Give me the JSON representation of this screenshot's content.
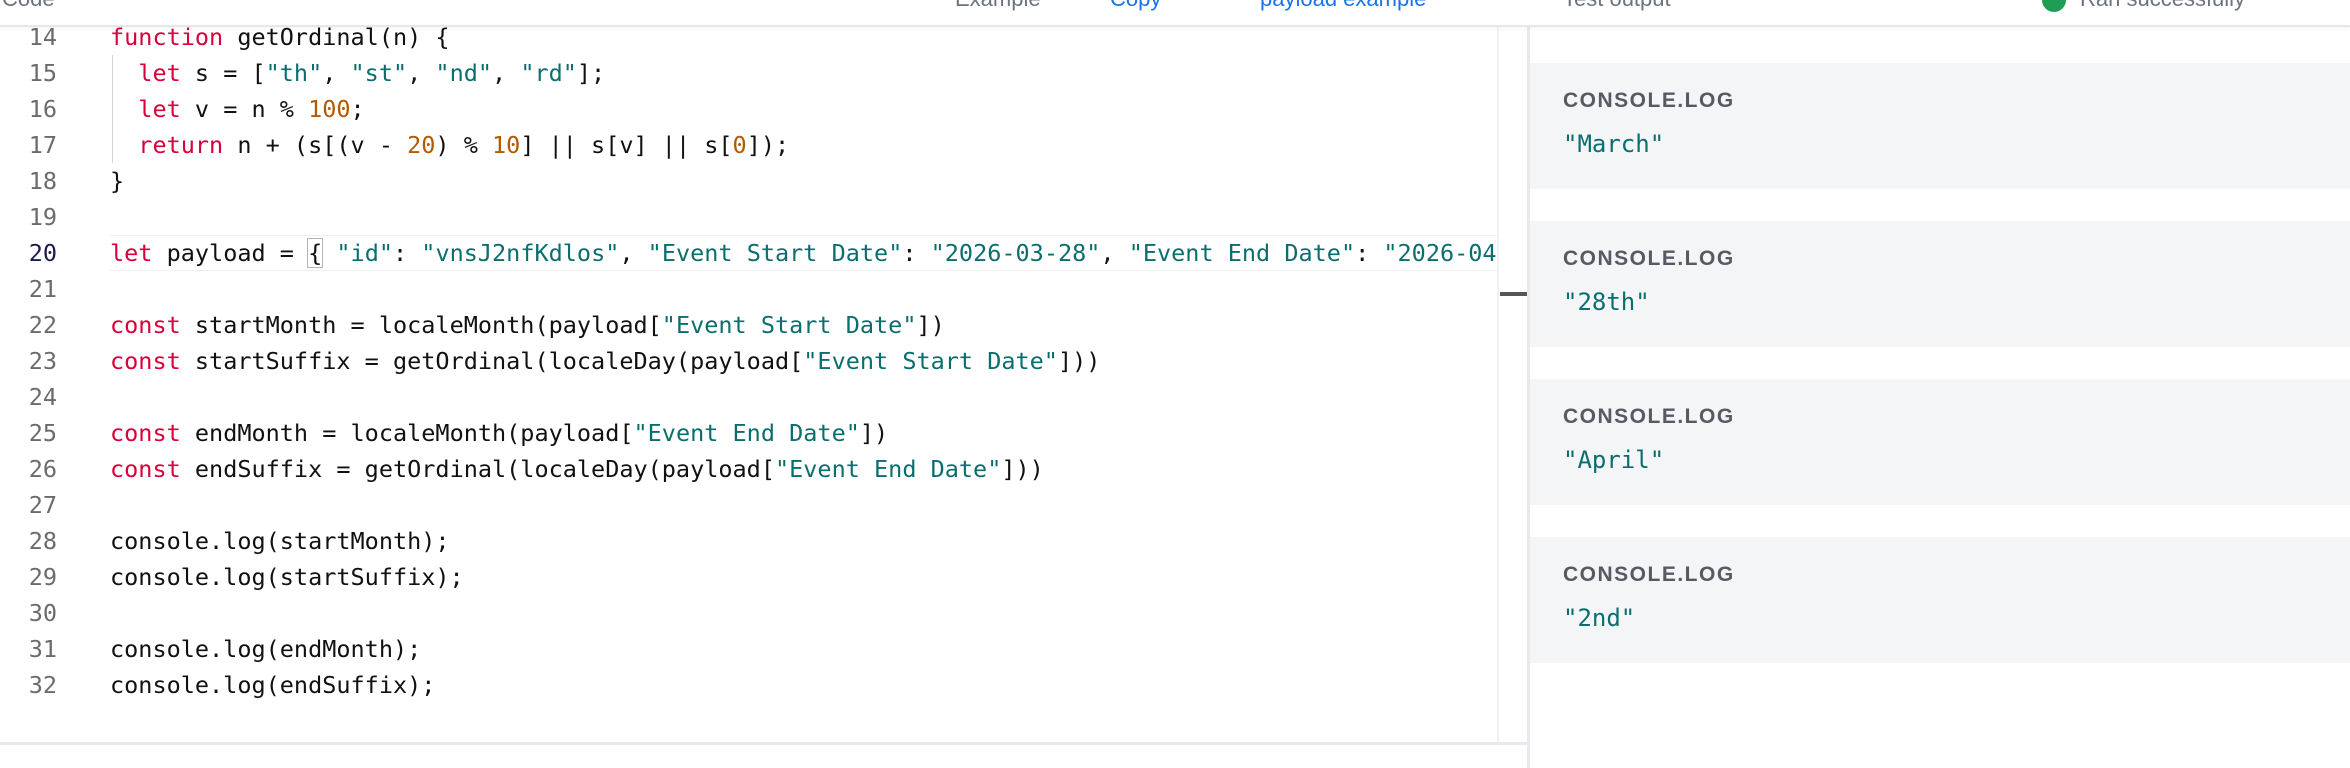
{
  "header": {
    "left_fragment": "Code",
    "mid_fragment_1": "Example",
    "mid_fragment_2": "Copy",
    "mid_fragment_3": "payload example",
    "output_fragment": "Test output",
    "status_text": "Ran successfully"
  },
  "editor": {
    "active_line": 20,
    "lines": [
      {
        "n": "14",
        "tokens": [
          [
            "kw",
            "function"
          ],
          [
            "pl",
            " getOrdinal(n) {"
          ]
        ]
      },
      {
        "n": "15",
        "tokens": [
          [
            "pl",
            "  "
          ],
          [
            "kw",
            "let"
          ],
          [
            "pl",
            " s = ["
          ],
          [
            "str",
            "\"th\""
          ],
          [
            "pl",
            ", "
          ],
          [
            "str",
            "\"st\""
          ],
          [
            "pl",
            ", "
          ],
          [
            "str",
            "\"nd\""
          ],
          [
            "pl",
            ", "
          ],
          [
            "str",
            "\"rd\""
          ],
          [
            "pl",
            "];"
          ]
        ]
      },
      {
        "n": "16",
        "tokens": [
          [
            "pl",
            "  "
          ],
          [
            "kw",
            "let"
          ],
          [
            "pl",
            " v = n % "
          ],
          [
            "num",
            "100"
          ],
          [
            "pl",
            ";"
          ]
        ]
      },
      {
        "n": "17",
        "tokens": [
          [
            "pl",
            "  "
          ],
          [
            "kw",
            "return"
          ],
          [
            "pl",
            " n + (s[(v - "
          ],
          [
            "num",
            "20"
          ],
          [
            "pl",
            ") % "
          ],
          [
            "num",
            "10"
          ],
          [
            "pl",
            "] || s[v] || s["
          ],
          [
            "num",
            "0"
          ],
          [
            "pl",
            "]);"
          ]
        ]
      },
      {
        "n": "18",
        "tokens": [
          [
            "pl",
            "}"
          ]
        ]
      },
      {
        "n": "19",
        "tokens": []
      },
      {
        "n": "20",
        "tokens": [
          [
            "kw",
            "let"
          ],
          [
            "pl",
            " payload = "
          ],
          [
            "brace",
            "{"
          ],
          [
            "pl",
            " "
          ],
          [
            "str",
            "\"id\""
          ],
          [
            "pl",
            ": "
          ],
          [
            "str",
            "\"vnsJ2nfKdlos\""
          ],
          [
            "pl",
            ", "
          ],
          [
            "str",
            "\"Event Start Date\""
          ],
          [
            "pl",
            ": "
          ],
          [
            "str",
            "\"2026-03-28\""
          ],
          [
            "pl",
            ", "
          ],
          [
            "str",
            "\"Event End Date\""
          ],
          [
            "pl",
            ": "
          ],
          [
            "str",
            "\"2026-04"
          ]
        ]
      },
      {
        "n": "21",
        "tokens": []
      },
      {
        "n": "22",
        "tokens": [
          [
            "kw",
            "const"
          ],
          [
            "pl",
            " startMonth = localeMonth(payload["
          ],
          [
            "str",
            "\"Event Start Date\""
          ],
          [
            "pl",
            "])"
          ]
        ]
      },
      {
        "n": "23",
        "tokens": [
          [
            "kw",
            "const"
          ],
          [
            "pl",
            " startSuffix = getOrdinal(localeDay(payload["
          ],
          [
            "str",
            "\"Event Start Date\""
          ],
          [
            "pl",
            "]))"
          ]
        ]
      },
      {
        "n": "24",
        "tokens": []
      },
      {
        "n": "25",
        "tokens": [
          [
            "kw",
            "const"
          ],
          [
            "pl",
            " endMonth = localeMonth(payload["
          ],
          [
            "str",
            "\"Event End Date\""
          ],
          [
            "pl",
            "])"
          ]
        ]
      },
      {
        "n": "26",
        "tokens": [
          [
            "kw",
            "const"
          ],
          [
            "pl",
            " endSuffix = getOrdinal(localeDay(payload["
          ],
          [
            "str",
            "\"Event End Date\""
          ],
          [
            "pl",
            "]))"
          ]
        ]
      },
      {
        "n": "27",
        "tokens": []
      },
      {
        "n": "28",
        "tokens": [
          [
            "pl",
            "console.log(startMonth);"
          ]
        ]
      },
      {
        "n": "29",
        "tokens": [
          [
            "pl",
            "console.log(startSuffix);"
          ]
        ]
      },
      {
        "n": "30",
        "tokens": []
      },
      {
        "n": "31",
        "tokens": [
          [
            "pl",
            "console.log(endMonth);"
          ]
        ]
      },
      {
        "n": "32",
        "tokens": [
          [
            "pl",
            "console.log(endSuffix);"
          ]
        ]
      }
    ]
  },
  "console": {
    "entries": [
      {
        "label": "CONSOLE.LOG",
        "value": "\"March\""
      },
      {
        "label": "CONSOLE.LOG",
        "value": "\"28th\""
      },
      {
        "label": "CONSOLE.LOG",
        "value": "\"April\""
      },
      {
        "label": "CONSOLE.LOG",
        "value": "\"2nd\""
      }
    ]
  },
  "colors": {
    "keyword": "#d7003a",
    "string": "#0b6e6e",
    "number": "#b35900",
    "card_bg": "#f4f5f7",
    "success": "#1f9d55"
  }
}
